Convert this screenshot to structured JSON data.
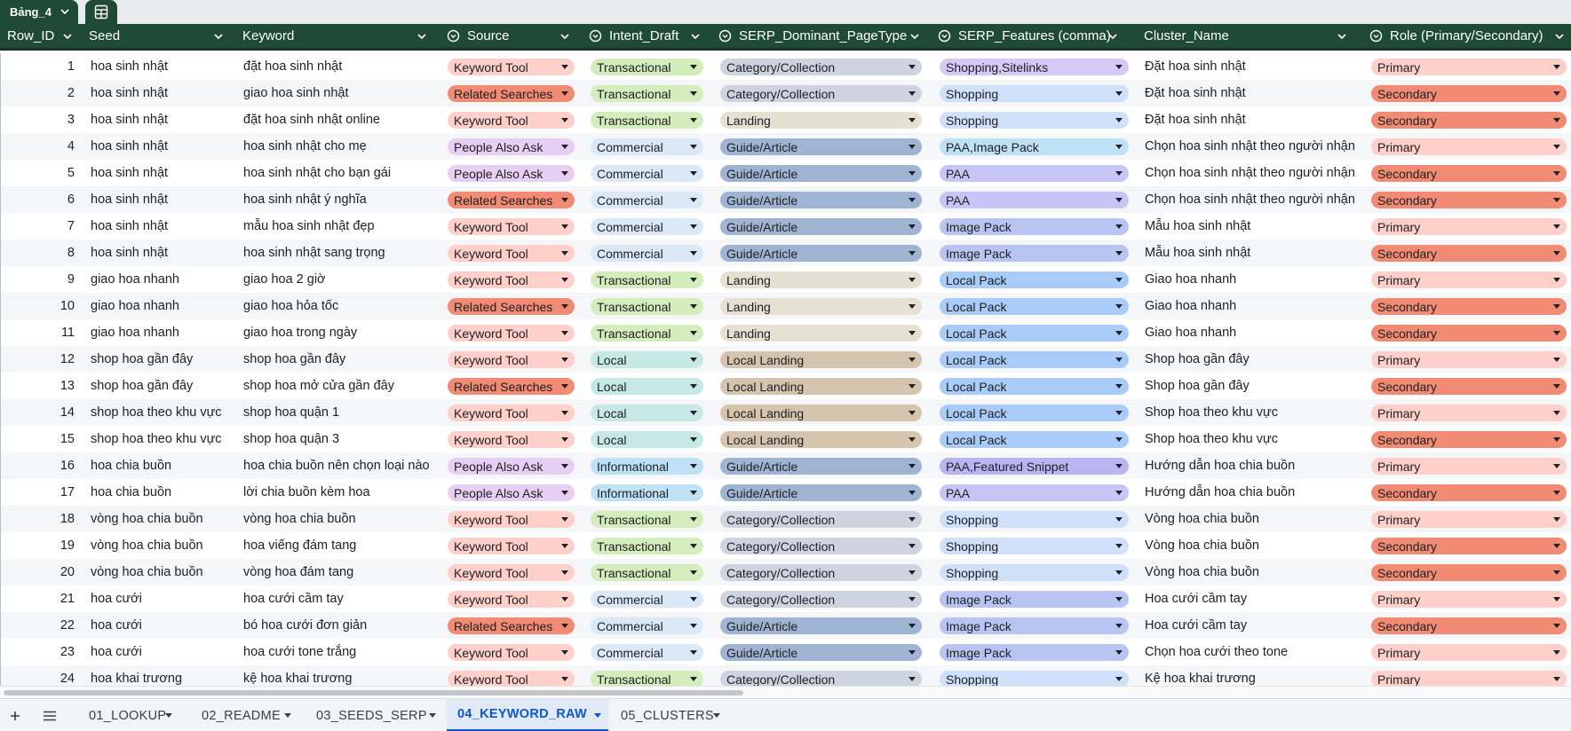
{
  "table_tab": {
    "label": "Bảng_4"
  },
  "headers": {
    "row_id": "Row_ID",
    "seed": "Seed",
    "keyword": "Keyword",
    "source": "Source",
    "intent": "Intent_Draft",
    "page_type": "SERP_Dominant_PageType",
    "features": "SERP_Features (comma)",
    "cluster": "Cluster_Name",
    "role": "Role (Primary/Secondary)"
  },
  "rows": [
    {
      "id": "1",
      "seed": "hoa sinh nhật",
      "keyword": "đặt hoa sinh nhật",
      "source": "Keyword Tool",
      "intent": "Transactional",
      "page_type": "Category/Collection",
      "features": "Shopping,Sitelinks",
      "cluster": "Đặt hoa sinh nhật",
      "role": "Primary"
    },
    {
      "id": "2",
      "seed": "hoa sinh nhật",
      "keyword": "giao hoa sinh nhật",
      "source": "Related Searches",
      "intent": "Transactional",
      "page_type": "Category/Collection",
      "features": "Shopping",
      "cluster": "Đặt hoa sinh nhật",
      "role": "Secondary"
    },
    {
      "id": "3",
      "seed": "hoa sinh nhật",
      "keyword": "đặt hoa sinh nhật online",
      "source": "Keyword Tool",
      "intent": "Transactional",
      "page_type": "Landing",
      "features": "Shopping",
      "cluster": "Đặt hoa sinh nhật",
      "role": "Secondary"
    },
    {
      "id": "4",
      "seed": "hoa sinh nhật",
      "keyword": "hoa sinh nhật cho mẹ",
      "source": "People Also Ask",
      "intent": "Commercial",
      "page_type": "Guide/Article",
      "features": "PAA,Image Pack",
      "cluster": "Chọn hoa sinh nhật theo người nhận",
      "role": "Primary"
    },
    {
      "id": "5",
      "seed": "hoa sinh nhật",
      "keyword": "hoa sinh nhật cho bạn gái",
      "source": "People Also Ask",
      "intent": "Commercial",
      "page_type": "Guide/Article",
      "features": "PAA",
      "cluster": "Chọn hoa sinh nhật theo người nhận",
      "role": "Secondary"
    },
    {
      "id": "6",
      "seed": "hoa sinh nhật",
      "keyword": "hoa sinh nhật ý nghĩa",
      "source": "Related Searches",
      "intent": "Commercial",
      "page_type": "Guide/Article",
      "features": "PAA",
      "cluster": "Chọn hoa sinh nhật theo người nhận",
      "role": "Secondary"
    },
    {
      "id": "7",
      "seed": "hoa sinh nhật",
      "keyword": "mẫu hoa sinh nhật đẹp",
      "source": "Keyword Tool",
      "intent": "Commercial",
      "page_type": "Guide/Article",
      "features": "Image Pack",
      "cluster": "Mẫu hoa sinh nhật",
      "role": "Primary"
    },
    {
      "id": "8",
      "seed": "hoa sinh nhật",
      "keyword": "hoa sinh nhật sang trọng",
      "source": "Keyword Tool",
      "intent": "Commercial",
      "page_type": "Guide/Article",
      "features": "Image Pack",
      "cluster": "Mẫu hoa sinh nhật",
      "role": "Secondary"
    },
    {
      "id": "9",
      "seed": "giao hoa nhanh",
      "keyword": "giao hoa 2 giờ",
      "source": "Keyword Tool",
      "intent": "Transactional",
      "page_type": "Landing",
      "features": "Local Pack",
      "cluster": "Giao hoa nhanh",
      "role": "Primary"
    },
    {
      "id": "10",
      "seed": "giao hoa nhanh",
      "keyword": "giao hoa hỏa tốc",
      "source": "Related Searches",
      "intent": "Transactional",
      "page_type": "Landing",
      "features": "Local Pack",
      "cluster": "Giao hoa nhanh",
      "role": "Secondary"
    },
    {
      "id": "11",
      "seed": "giao hoa nhanh",
      "keyword": "giao hoa trong ngày",
      "source": "Keyword Tool",
      "intent": "Transactional",
      "page_type": "Landing",
      "features": "Local Pack",
      "cluster": "Giao hoa nhanh",
      "role": "Secondary"
    },
    {
      "id": "12",
      "seed": "shop hoa gần đây",
      "keyword": "shop hoa gần đây",
      "source": "Keyword Tool",
      "intent": "Local",
      "page_type": "Local Landing",
      "features": "Local Pack",
      "cluster": "Shop hoa gần đây",
      "role": "Primary"
    },
    {
      "id": "13",
      "seed": "shop hoa gần đây",
      "keyword": "shop hoa mở cửa gần đây",
      "source": "Related Searches",
      "intent": "Local",
      "page_type": "Local Landing",
      "features": "Local Pack",
      "cluster": "Shop hoa gần đây",
      "role": "Secondary"
    },
    {
      "id": "14",
      "seed": "shop hoa theo khu vực",
      "keyword": "shop hoa quận 1",
      "source": "Keyword Tool",
      "intent": "Local",
      "page_type": "Local Landing",
      "features": "Local Pack",
      "cluster": "Shop hoa theo khu vực",
      "role": "Primary"
    },
    {
      "id": "15",
      "seed": "shop hoa theo khu vực",
      "keyword": "shop hoa quận 3",
      "source": "Keyword Tool",
      "intent": "Local",
      "page_type": "Local Landing",
      "features": "Local Pack",
      "cluster": "Shop hoa theo khu vực",
      "role": "Secondary"
    },
    {
      "id": "16",
      "seed": "hoa chia buồn",
      "keyword": "hoa chia buồn nên chọn loại nào",
      "source": "People Also Ask",
      "intent": "Informational",
      "page_type": "Guide/Article",
      "features": "PAA,Featured Snippet",
      "cluster": "Hướng dẫn hoa chia buồn",
      "role": "Primary"
    },
    {
      "id": "17",
      "seed": "hoa chia buồn",
      "keyword": "lời chia buồn kèm hoa",
      "source": "People Also Ask",
      "intent": "Informational",
      "page_type": "Guide/Article",
      "features": "PAA",
      "cluster": "Hướng dẫn hoa chia buồn",
      "role": "Secondary"
    },
    {
      "id": "18",
      "seed": "vòng hoa chia buồn",
      "keyword": "vòng hoa chia buồn",
      "source": "Keyword Tool",
      "intent": "Transactional",
      "page_type": "Category/Collection",
      "features": "Shopping",
      "cluster": "Vòng hoa chia buồn",
      "role": "Primary"
    },
    {
      "id": "19",
      "seed": "vòng hoa chia buồn",
      "keyword": "hoa viếng đám tang",
      "source": "Keyword Tool",
      "intent": "Transactional",
      "page_type": "Category/Collection",
      "features": "Shopping",
      "cluster": "Vòng hoa chia buồn",
      "role": "Secondary"
    },
    {
      "id": "20",
      "seed": "vòng hoa chia buồn",
      "keyword": "vòng hoa đám tang",
      "source": "Keyword Tool",
      "intent": "Transactional",
      "page_type": "Category/Collection",
      "features": "Shopping",
      "cluster": "Vòng hoa chia buồn",
      "role": "Secondary"
    },
    {
      "id": "21",
      "seed": "hoa cưới",
      "keyword": "hoa cưới cầm tay",
      "source": "Keyword Tool",
      "intent": "Commercial",
      "page_type": "Category/Collection",
      "features": "Image Pack",
      "cluster": "Hoa cưới cầm tay",
      "role": "Primary"
    },
    {
      "id": "22",
      "seed": "hoa cưới",
      "keyword": "bó hoa cưới đơn giản",
      "source": "Related Searches",
      "intent": "Commercial",
      "page_type": "Guide/Article",
      "features": "Image Pack",
      "cluster": "Hoa cưới cầm tay",
      "role": "Secondary"
    },
    {
      "id": "23",
      "seed": "hoa cưới",
      "keyword": "hoa cưới tone trắng",
      "source": "Keyword Tool",
      "intent": "Commercial",
      "page_type": "Guide/Article",
      "features": "Image Pack",
      "cluster": "Chọn hoa cưới theo tone",
      "role": "Primary"
    },
    {
      "id": "24",
      "seed": "hoa khai trương",
      "keyword": "kệ hoa khai trương",
      "source": "Keyword Tool",
      "intent": "Transactional",
      "page_type": "Category/Collection",
      "features": "Shopping",
      "cluster": "Kệ hoa khai trương",
      "role": "Primary"
    }
  ],
  "chip_colors": {
    "source": {
      "Keyword Tool": "#ffcfc9",
      "Related Searches": "#f28b74",
      "People Also Ask": "#e6cff2"
    },
    "intent": {
      "Transactional": "#d4edbc",
      "Commercial": "#dbe8f7",
      "Local": "#c6e9e5",
      "Informational": "#bfe1f6"
    },
    "page_type": {
      "Category/Collection": "#cdd4e0",
      "Landing": "#e6e0d2",
      "Guide/Article": "#9fb4d2",
      "Local Landing": "#d5c4ae"
    },
    "features": {
      "Shopping,Sitelinks": "#d8c8f7",
      "Shopping": "#cfe0fb",
      "PAA,Image Pack": "#bfe1f6",
      "PAA": "#c7c5f6",
      "Image Pack": "#b8c4f2",
      "Local Pack": "#a9cbf7",
      "PAA,Featured Snippet": "#bcb4f2"
    },
    "role": {
      "Primary": "#ffcfc9",
      "Secondary": "#f28b74"
    }
  },
  "sheet_tabs": [
    {
      "label": "01_LOOKUP",
      "active": false
    },
    {
      "label": "02_README",
      "active": false
    },
    {
      "label": "03_SEEDS_SERP",
      "active": false
    },
    {
      "label": "04_KEYWORD_RAW",
      "active": true
    },
    {
      "label": "05_CLUSTERS",
      "active": false
    }
  ],
  "icons": {
    "add_sheet": "plus-icon",
    "all_sheets": "menu-icon",
    "calc": "calculator-icon",
    "dropdown_column": "dropdown-chip-icon"
  }
}
